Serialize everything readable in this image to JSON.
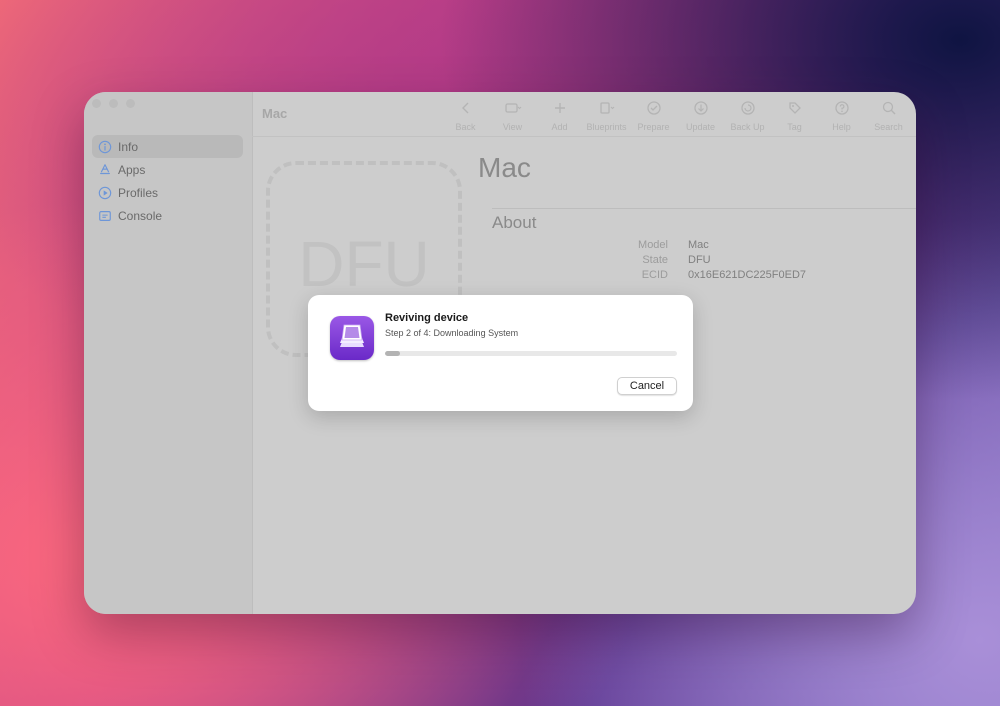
{
  "window": {
    "title": "Mac"
  },
  "toolbar": {
    "items": [
      {
        "label": "Back",
        "icon": "chevron-left-icon"
      },
      {
        "label": "View",
        "icon": "view-icon"
      },
      {
        "label": "Add",
        "icon": "plus-icon"
      },
      {
        "label": "Blueprints",
        "icon": "blueprints-icon"
      },
      {
        "label": "Prepare",
        "icon": "prepare-icon"
      },
      {
        "label": "Update",
        "icon": "update-icon"
      },
      {
        "label": "Back Up",
        "icon": "backup-icon"
      },
      {
        "label": "Tag",
        "icon": "tag-icon"
      },
      {
        "label": "Help",
        "icon": "help-icon"
      },
      {
        "label": "Search",
        "icon": "search-icon"
      }
    ]
  },
  "sidebar": {
    "items": [
      {
        "label": "Info",
        "icon": "info-icon",
        "selected": true
      },
      {
        "label": "Apps",
        "icon": "apps-icon"
      },
      {
        "label": "Profiles",
        "icon": "profiles-icon"
      },
      {
        "label": "Console",
        "icon": "console-icon"
      }
    ]
  },
  "device": {
    "placeholder": "DFU",
    "name": "Mac",
    "about_heading": "About",
    "details": [
      {
        "key": "Model",
        "value": "Mac"
      },
      {
        "key": "State",
        "value": "DFU"
      },
      {
        "key": "ECID",
        "value": "0x16E621DC225F0ED7"
      }
    ]
  },
  "dialog": {
    "title": "Reviving device",
    "subtitle": "Step 2 of 4: Downloading System",
    "progress": 0.05,
    "cancel_label": "Cancel"
  },
  "colors": {
    "accent": "#6a29c8",
    "sidebar_icon": "#5a8ad8"
  }
}
